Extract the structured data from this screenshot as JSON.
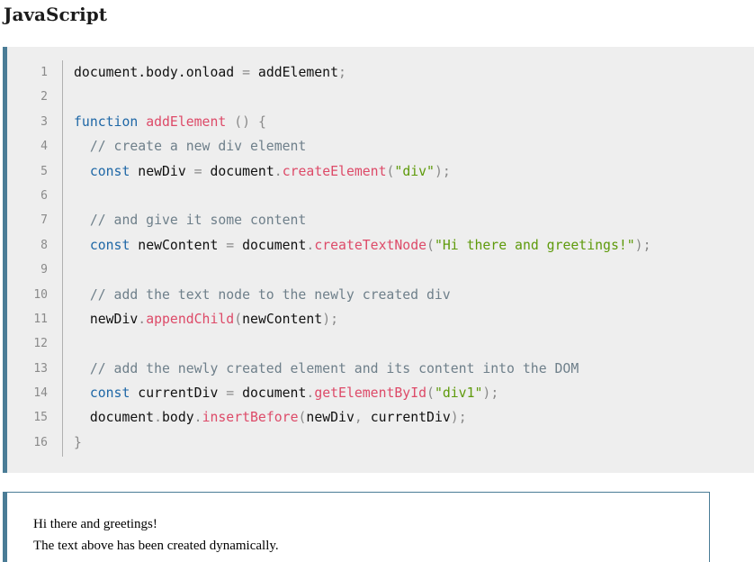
{
  "heading": "JavaScript",
  "code": {
    "lines": [
      {
        "n": "1",
        "tokens": [
          {
            "t": "document.body.onload ",
            "c": "plain"
          },
          {
            "t": "=",
            "c": "punc"
          },
          {
            "t": " addElement",
            "c": "plain"
          },
          {
            "t": ";",
            "c": "punc"
          }
        ]
      },
      {
        "n": "2",
        "tokens": []
      },
      {
        "n": "3",
        "tokens": [
          {
            "t": "function",
            "c": "kw"
          },
          {
            "t": " ",
            "c": "plain"
          },
          {
            "t": "addElement",
            "c": "fn"
          },
          {
            "t": " ",
            "c": "plain"
          },
          {
            "t": "()",
            "c": "punc"
          },
          {
            "t": " ",
            "c": "plain"
          },
          {
            "t": "{",
            "c": "punc"
          }
        ]
      },
      {
        "n": "4",
        "tokens": [
          {
            "t": "  // create a new div element",
            "c": "cm"
          }
        ]
      },
      {
        "n": "5",
        "tokens": [
          {
            "t": "  ",
            "c": "plain"
          },
          {
            "t": "const",
            "c": "kw"
          },
          {
            "t": " newDiv ",
            "c": "plain"
          },
          {
            "t": "=",
            "c": "punc"
          },
          {
            "t": " document",
            "c": "plain"
          },
          {
            "t": ".",
            "c": "punc"
          },
          {
            "t": "createElement",
            "c": "fn"
          },
          {
            "t": "(",
            "c": "punc"
          },
          {
            "t": "\"div\"",
            "c": "str"
          },
          {
            "t": ");",
            "c": "punc"
          }
        ]
      },
      {
        "n": "6",
        "tokens": []
      },
      {
        "n": "7",
        "tokens": [
          {
            "t": "  // and give it some content",
            "c": "cm"
          }
        ]
      },
      {
        "n": "8",
        "tokens": [
          {
            "t": "  ",
            "c": "plain"
          },
          {
            "t": "const",
            "c": "kw"
          },
          {
            "t": " newContent ",
            "c": "plain"
          },
          {
            "t": "=",
            "c": "punc"
          },
          {
            "t": " document",
            "c": "plain"
          },
          {
            "t": ".",
            "c": "punc"
          },
          {
            "t": "createTextNode",
            "c": "fn"
          },
          {
            "t": "(",
            "c": "punc"
          },
          {
            "t": "\"Hi there and greetings!\"",
            "c": "str"
          },
          {
            "t": ");",
            "c": "punc"
          }
        ]
      },
      {
        "n": "9",
        "tokens": []
      },
      {
        "n": "10",
        "tokens": [
          {
            "t": "  // add the text node to the newly created div",
            "c": "cm"
          }
        ]
      },
      {
        "n": "11",
        "tokens": [
          {
            "t": "  newDiv",
            "c": "plain"
          },
          {
            "t": ".",
            "c": "punc"
          },
          {
            "t": "appendChild",
            "c": "fn"
          },
          {
            "t": "(",
            "c": "punc"
          },
          {
            "t": "newContent",
            "c": "plain"
          },
          {
            "t": ");",
            "c": "punc"
          }
        ]
      },
      {
        "n": "12",
        "tokens": []
      },
      {
        "n": "13",
        "tokens": [
          {
            "t": "  // add the newly created element and its content into the DOM",
            "c": "cm"
          }
        ]
      },
      {
        "n": "14",
        "tokens": [
          {
            "t": "  ",
            "c": "plain"
          },
          {
            "t": "const",
            "c": "kw"
          },
          {
            "t": " currentDiv ",
            "c": "plain"
          },
          {
            "t": "=",
            "c": "punc"
          },
          {
            "t": " document",
            "c": "plain"
          },
          {
            "t": ".",
            "c": "punc"
          },
          {
            "t": "getElementById",
            "c": "fn"
          },
          {
            "t": "(",
            "c": "punc"
          },
          {
            "t": "\"div1\"",
            "c": "str"
          },
          {
            "t": ");",
            "c": "punc"
          }
        ]
      },
      {
        "n": "15",
        "tokens": [
          {
            "t": "  document",
            "c": "plain"
          },
          {
            "t": ".",
            "c": "punc"
          },
          {
            "t": "body",
            "c": "plain"
          },
          {
            "t": ".",
            "c": "punc"
          },
          {
            "t": "insertBefore",
            "c": "fn"
          },
          {
            "t": "(",
            "c": "punc"
          },
          {
            "t": "newDiv",
            "c": "plain"
          },
          {
            "t": ",",
            "c": "punc"
          },
          {
            "t": " currentDiv",
            "c": "plain"
          },
          {
            "t": ");",
            "c": "punc"
          }
        ]
      },
      {
        "n": "16",
        "tokens": [
          {
            "t": "}",
            "c": "punc"
          }
        ]
      }
    ]
  },
  "output": {
    "line1": "Hi there and greetings!",
    "line2": "The text above has been created dynamically."
  },
  "colors": {
    "accent": "#4a7c96",
    "code_bg": "#eeeeee",
    "keyword": "#1e67a6",
    "function": "#dd4a68",
    "string": "#5e9a0b",
    "comment": "#6e7f8a"
  }
}
